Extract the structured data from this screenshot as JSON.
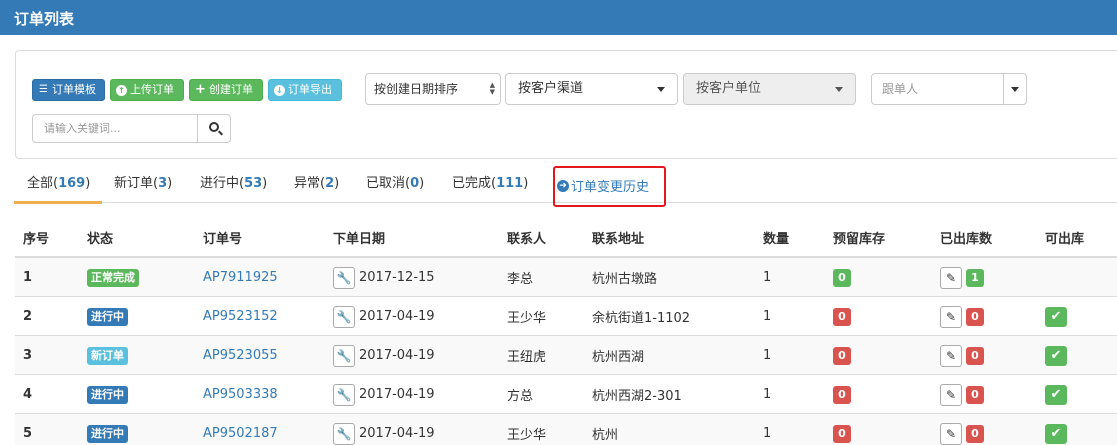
{
  "header": {
    "title": "订单列表"
  },
  "toolbar": {
    "template_label": "订单模板",
    "upload_label": "上传订单",
    "create_label": "创建订单",
    "export_label": "订单导出"
  },
  "filters": {
    "sort_value": "按创建日期排序",
    "channel_value": "按客户渠道",
    "unit_value": "按客户单位",
    "follower_placeholder": "跟单人",
    "keyword_placeholder": "请输入关键词..."
  },
  "tabs": [
    {
      "label": "全部(",
      "count": "169",
      "suffix": ")"
    },
    {
      "label": "新订单(",
      "count": "3",
      "suffix": ")"
    },
    {
      "label": "进行中(",
      "count": "53",
      "suffix": ")"
    },
    {
      "label": "异常(",
      "count": "2",
      "suffix": ")"
    },
    {
      "label": "已取消(",
      "count": "0",
      "suffix": ")"
    },
    {
      "label": "已完成(",
      "count": "111",
      "suffix": ")"
    }
  ],
  "history_link": "订单变更历史",
  "table": {
    "columns": [
      "序号",
      "状态",
      "订单号",
      "下单日期",
      "联系人",
      "联系地址",
      "数量",
      "预留库存",
      "已出库数",
      "可出库"
    ],
    "rows": [
      {
        "index": "1",
        "status": "正常完成",
        "status_color": "#5cb85c",
        "order_no": "AP7911925",
        "date": "2017-12-15",
        "contact": "李总",
        "address": "杭州古墩路",
        "qty": "1",
        "reserved": "0",
        "reserved_color": "#5cb85c",
        "shipped": "1",
        "shipped_color": "#5cb85c",
        "can_ship": false
      },
      {
        "index": "2",
        "status": "进行中",
        "status_color": "#337ab7",
        "order_no": "AP9523152",
        "date": "2017-04-19",
        "contact": "王少华",
        "address": "余杭街道1-1102",
        "qty": "1",
        "reserved": "0",
        "reserved_color": "#d9534f",
        "shipped": "0",
        "shipped_color": "#d9534f",
        "can_ship": true
      },
      {
        "index": "3",
        "status": "新订单",
        "status_color": "#5bc0de",
        "order_no": "AP9523055",
        "date": "2017-04-19",
        "contact": "王纽虎",
        "address": "杭州西湖",
        "qty": "1",
        "reserved": "0",
        "reserved_color": "#d9534f",
        "shipped": "0",
        "shipped_color": "#d9534f",
        "can_ship": true
      },
      {
        "index": "4",
        "status": "进行中",
        "status_color": "#337ab7",
        "order_no": "AP9503338",
        "date": "2017-04-19",
        "contact": "方总",
        "address": "杭州西湖2-301",
        "qty": "1",
        "reserved": "0",
        "reserved_color": "#d9534f",
        "shipped": "0",
        "shipped_color": "#d9534f",
        "can_ship": true
      },
      {
        "index": "5",
        "status": "进行中",
        "status_color": "#337ab7",
        "order_no": "AP9502187",
        "date": "2017-04-19",
        "contact": "王少华",
        "address": "杭州",
        "qty": "1",
        "reserved": "0",
        "reserved_color": "#d9534f",
        "shipped": "0",
        "shipped_color": "#d9534f",
        "can_ship": true
      }
    ]
  },
  "colors": {
    "primary": "#337ab7",
    "success": "#5cb85c",
    "info": "#5bc0de",
    "danger": "#d9534f",
    "warning": "#f0ad4e",
    "highlight": "#e3171f"
  }
}
